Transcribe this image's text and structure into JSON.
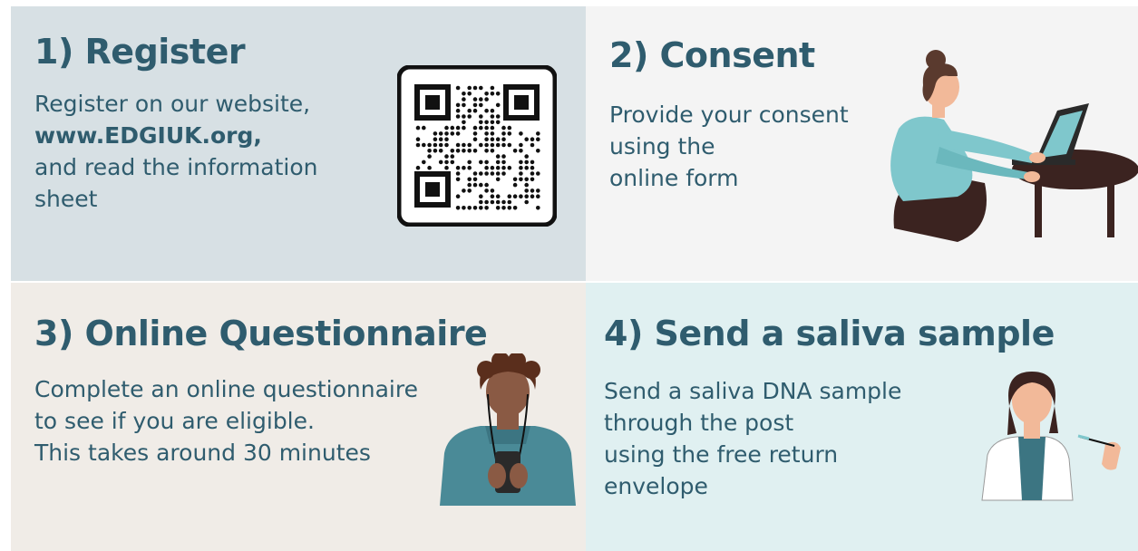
{
  "steps": [
    {
      "title": "1) Register",
      "lines": [
        "Register on our website,",
        "www.EDGIUK.org,",
        "and read the information",
        "sheet"
      ]
    },
    {
      "title": "2) Consent",
      "lines": [
        "Provide your consent",
        "using the",
        "online form"
      ]
    },
    {
      "title": "3) Online Questionnaire",
      "lines": [
        "Complete an online questionnaire",
        "to see if you are eligible.",
        "This takes around 30 minutes"
      ]
    },
    {
      "title": "4) Send a saliva sample",
      "lines": [
        "Send a saliva DNA sample",
        "through the post",
        "using the free return",
        "envelope"
      ]
    }
  ],
  "icons": {
    "qr": "qr-code-icon",
    "laptop_person": "person-with-laptop-icon",
    "phone_person": "person-with-phone-icon",
    "saliva_person": "person-with-swab-icon"
  },
  "colors": {
    "heading": "#2f5c6e",
    "panel1": "#d7e0e4",
    "panel2": "#f4f4f4",
    "panel3": "#f0ece7",
    "panel4": "#e0f0f1",
    "teal": "#7fc7cc",
    "dark_brown": "#3b2320"
  }
}
